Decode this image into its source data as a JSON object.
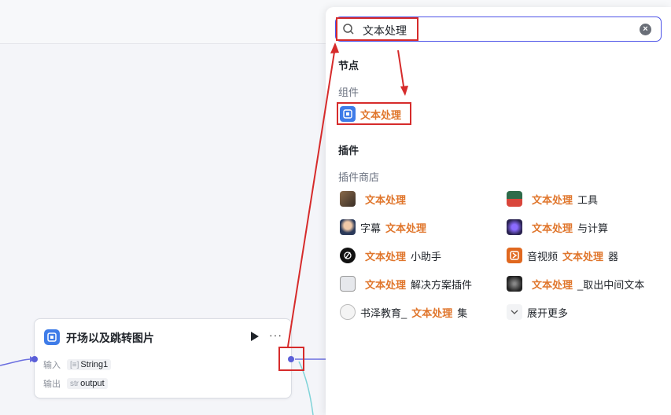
{
  "node": {
    "title": "开场以及跳转图片",
    "input_label": "输入",
    "input_type": "[≡]",
    "input_value": "String1",
    "output_label": "输出",
    "output_type": "str",
    "output_value": "output",
    "run_icon": "play-icon",
    "more_label": "···"
  },
  "search": {
    "query": "文本处理",
    "clear_icon": "clear-icon"
  },
  "sections": {
    "nodes": "节点",
    "component": "组件",
    "plugins": "插件",
    "plugin_store": "插件商店"
  },
  "component_item": {
    "highlight": "文本处理",
    "rest": ""
  },
  "plugin_items": [
    {
      "highlight": "文本处理",
      "rest": "",
      "prefix": ""
    },
    {
      "highlight": "文本处理",
      "rest": "工具",
      "prefix": ""
    },
    {
      "prefix": "字幕",
      "highlight": "文本处理",
      "rest": ""
    },
    {
      "prefix": "",
      "highlight": "文本处理",
      "rest": "与计算"
    },
    {
      "prefix": "",
      "highlight": "文本处理",
      "rest": "小助手"
    },
    {
      "prefix": "音视频",
      "highlight": "文本处理",
      "rest": "器"
    },
    {
      "prefix": "",
      "highlight": "文本处理",
      "rest": "解决方案插件"
    },
    {
      "prefix": "",
      "highlight": "文本处理",
      "rest": "_取出中间文本"
    },
    {
      "prefix": "书泽教育_",
      "highlight": "文本处理",
      "rest": "集"
    }
  ],
  "show_more": "展开更多",
  "colors": {
    "highlight": "#e0762c",
    "annotation_red": "#d62b2b",
    "accent": "#4d53e8",
    "port": "#5b5fd8"
  }
}
